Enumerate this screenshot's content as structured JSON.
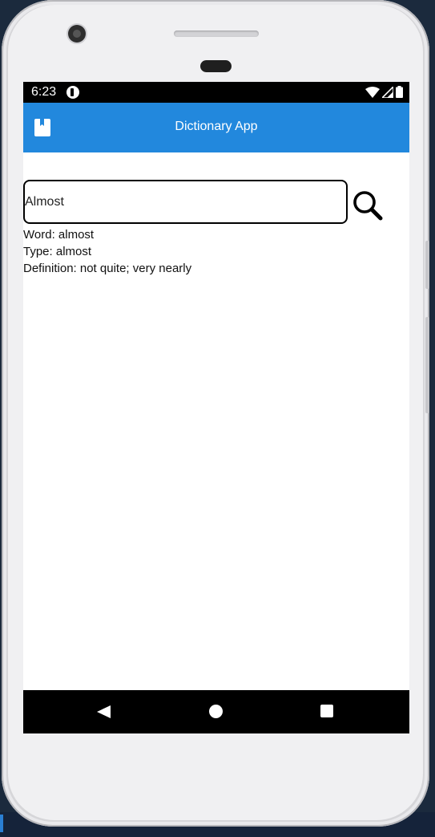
{
  "status_bar": {
    "time": "6:23",
    "icons": [
      "app-notification-icon",
      "wifi-icon",
      "cell-signal-icon",
      "battery-icon"
    ]
  },
  "app_bar": {
    "title": "Dictionary App",
    "leading_icon": "book-icon",
    "color": "#2288dd"
  },
  "search": {
    "value": "Almost",
    "button_icon": "search-icon"
  },
  "result": {
    "word_line": "Word: almost",
    "type_line": "Type: almost",
    "definition_line": "Definition: not quite; very nearly"
  },
  "nav_bar": {
    "buttons": [
      "back-icon",
      "home-icon",
      "recent-apps-icon"
    ]
  }
}
